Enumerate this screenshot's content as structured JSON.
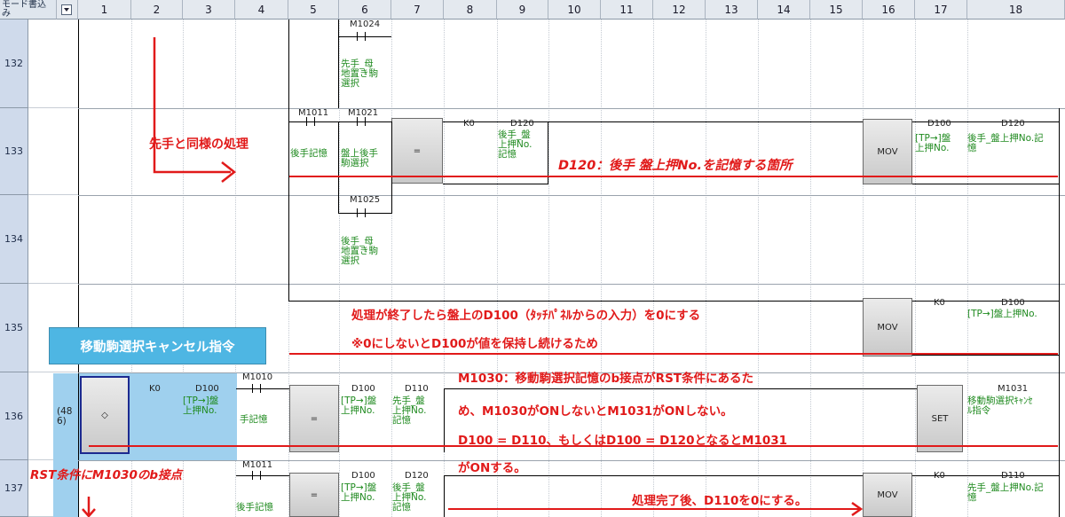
{
  "window": {
    "corner_label": "モード書込み"
  },
  "columns": [
    "1",
    "2",
    "3",
    "4",
    "5",
    "6",
    "7",
    "8",
    "9",
    "10",
    "11",
    "12",
    "13",
    "14",
    "15",
    "16",
    "17",
    "18"
  ],
  "rows": [
    {
      "num": "132"
    },
    {
      "num": "133"
    },
    {
      "num": "134"
    },
    {
      "num": "135"
    },
    {
      "num": "136"
    },
    {
      "num": "137"
    }
  ],
  "ladder": {
    "r132": {
      "contact": "M1024",
      "comment": "先手_母\n地置き駒\n選択"
    },
    "r133": {
      "c1": "M1011",
      "c1_comment": "後手記憶",
      "c2": "M1021",
      "c2_comment": "盤上後手\n駒選択",
      "cmp": "=",
      "s1": "K0",
      "s2": "D120",
      "s2_comment": "後手_盤\n上押No.\n記憶",
      "mov": "MOV",
      "src": "D100",
      "src_comment": "[TP→]盤\n上押No.",
      "dst": "D120",
      "dst_comment": "後手_盤上押No.記\n憶"
    },
    "r134": {
      "contact": "M1025",
      "comment": "後手_母\n地置き駒\n選択"
    },
    "r135": {
      "mov": "MOV",
      "src": "K0",
      "dst": "D100",
      "dst_comment": "[TP→]盤上押No."
    },
    "r136": {
      "step": "(48\n6)",
      "ne": "◇",
      "s1": "K0",
      "s2": "D100",
      "s2_comment": "[TP→]盤\n上押No.",
      "c1": "M1010",
      "c1_comment": "手記憶",
      "cmp": "=",
      "d1": "D100",
      "d1_comment": "[TP→]盤\n上押No.",
      "d2": "D110",
      "d2_comment": "先手_盤\n上押No.\n記憶",
      "set": "SET",
      "coil": "M1031",
      "coil_comment": "移動駒選択ｷｬﾝｾ\nﾙ指令"
    },
    "r137": {
      "c1": "M1011",
      "c1_comment": "後手記憶",
      "cmp": "=",
      "d1": "D100",
      "d1_comment": "[TP→]盤\n上押No.",
      "d2": "D120",
      "d2_comment": "後手_盤\n上押No.\n記憶",
      "mov": "MOV",
      "src": "K0",
      "dst": "D110",
      "dst_comment": "先手_盤上押No.記\n憶"
    }
  },
  "annotations": {
    "same_process": "先手と同様の処理",
    "d120": "D120：後手 盤上押No.を記憶する箇所",
    "zero_line1": "処理が終了したら盤上のD100（ﾀｯﾁﾊﾟﾈﾙからの入力）を0にする",
    "zero_line2": "※0にしないとD100が値を保持し続けるため",
    "cancel_title": "移動駒選択キャンセル指令",
    "m1030_line1": "M1030：移動駒選択記憶のb接点がRST条件にあるた",
    "m1030_line2": "め、M1030がONしないとM1031がONしない。",
    "m1030_line3": "D100 = D110、もしくはD100 = D120となるとM1031",
    "m1030_line4": "がONする。",
    "rst_note": "RST条件にM1030のb接点",
    "after_process": "処理完了後、D110を0にする。"
  },
  "colors": {
    "accent_red": "#e11a1a",
    "callout_blue": "#4eb6e3",
    "comment_green": "#1f8a1f"
  }
}
